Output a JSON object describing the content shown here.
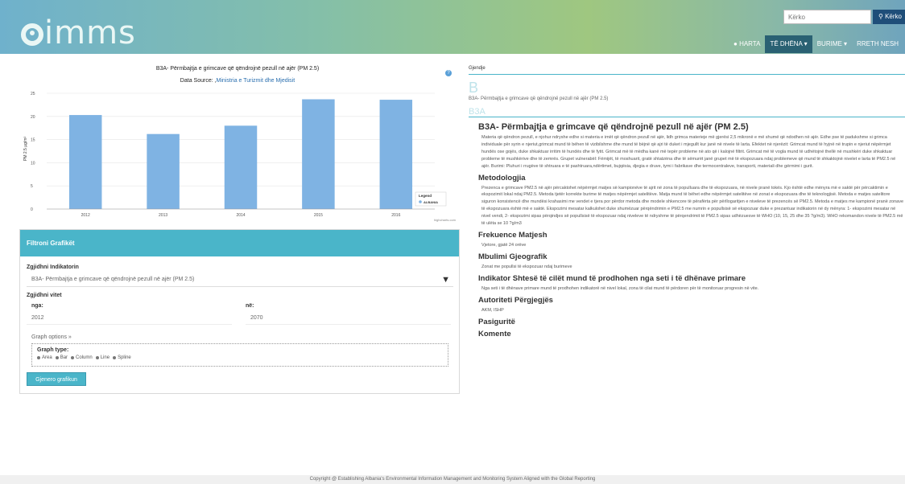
{
  "header": {
    "logo": "imms",
    "search_placeholder": "Kërko",
    "search_button": "Kërko",
    "nav": [
      "HARTA",
      "TË DHËNA",
      "BURIME",
      "RRETH NESH"
    ]
  },
  "chart_data": {
    "type": "bar",
    "title": "B3A- Përmbajtja e grimcave që qëndrojnë pezull në ajër (PM 2.5)",
    "source_label": "Data Source:",
    "source_link": "Ministria e Turizmit dhe Mjedisit",
    "categories": [
      "2012",
      "2013",
      "2014",
      "2015",
      "2016"
    ],
    "values": [
      20.3,
      16.2,
      18.0,
      23.7,
      23.6
    ],
    "ylabel": "PM 2.5 μg/m³",
    "ylim": [
      0,
      25
    ],
    "yticks": [
      0,
      5,
      10,
      15,
      20,
      25
    ],
    "legend_title": "Legend",
    "legend_item": "ALBANIA",
    "credit": "highcharts.com",
    "color": "#7fb3e3"
  },
  "filter": {
    "header": "Filtroni Grafikët",
    "indicator_label": "Zgjidhni Indikatorin",
    "indicator_value": "B3A- Përmbajtja e grimcave që qëndrojnë pezull në ajër (PM 2.5)",
    "years_label": "Zgjidhni vitet",
    "from_label": "nga:",
    "to_label": "në:",
    "from_value": "2012",
    "to_value": "2070",
    "graph_options": "Graph options »",
    "graph_type_label": "Graph type:",
    "graph_types": [
      "Area",
      "Bar",
      "Column",
      "Line",
      "Spline"
    ],
    "generate_button": "Gjenero grafikun"
  },
  "right": {
    "breadcrumb": "Gjendje",
    "big_letter": "B",
    "small_subtitle": "B3A- Përmbajtja e grimcave që qëndrojnë pezull në ajër (PM 2.5)",
    "code_heading": "B3A",
    "main_heading": "B3A- Përmbajtja e grimcave që qëndrojnë pezull në ajër (PM 2.5)",
    "intro": "Materia që qëndron pezull, e njohur ndryshe edhe si materia e imët që qëndron pezull në ajër, lidh grimca materieje më gjerësi 2,5 mikronë e më shumë që ndodhen në ajër. Edhe pse të padukshme si grimca individuale për syrin e njeriut,grimcat mund të bëhen të vizibilshme dhe mund të bëjnë që ajri të duket i mjegullt kur janë në nivele të larta. Efektet në njerëzit: Grimcat mund të hyjnë në trupin e njeriut nëpërmjet hundës ose gojës, duke shkaktuar irritim të hundës dhe të fytit. Grimcat më të mëdha kanë më tepër probleme në ato që i kalojnë filtrit. Grimcat më të vogla mund të udhëtojnë thellë në mushkëri duke shkaktuar probleme të mushkërive dhe të zemrës. Grupet vulnerabël: Fëmijët, të moshuarit, gratë shtatzëna dhe të sëmurët janë grupet më të ekspozuara ndaj problemeve që mund të shkaktojnë nivelet e larta të PM2.5 në ajër. Burimi: Pluhuri i rrugëve të shtruara e të pashtruara,ndërtimet, bujqësia, djegia e druve, tymi i fabrikave dhe termocentraleve, transporti, materiali dhe gërmimi i gurit.",
    "sections": [
      {
        "title": "Metodologjia",
        "text": "Prezenca e grimcave PM2.5 në ajër përcaktohet nëpërmjet matjes së kampionëve të ajrit në zona të populluara dhe të ekspozuara, në nivele pranë tokës. Kjo është edhe mënyra më e saktë për përcaktimin e ekspozimit lokal ndaj PM2.5. Metoda tjetër korrekte burime të matjes nëpërmjet satelitëve. Matja mund të bëhet edhe nëpërmjet satelitëve në zonat e ekspozuara dhe të teknologjisë. Metoda e matjes satelitore siguron konsistencë dhe mundësi krahasimi me vendet e tjera por përdor metoda dhe modele shkencore të përafërta për përllogaritjen e niveleve të prezencës së PM2.5. Metoda e matjes me kampionë pranë zonave të ekspozuara është më e saktë. Ekspozimi mesatar kalkulohet duke shumëzuar përqëndrimin e PM2.5 me numrin e popullsisë së ekspozuar duke e prezantuar indikatorin në dy mënyra: 1- ekspozimi mesatar në nivel vendi, 2- ekspozimi sipas përqindjes së popullsisë të ekspozuar ndaj niveleve të ndryshme të përqendrimit të PM2.5 sipas udhëzuesve të WHO (10, 15, 25 dhe 35 ?g/m3). WHO rekomandon nivele të PM2.5 më të ulëta se 10 ?g/m3"
      },
      {
        "title": "Frekuence Matjesh",
        "text": "Vjetore, gjatë 24 orëve"
      },
      {
        "title": "Mbulimi Gjeografik",
        "text": "Zonat me popullsi të ekspozuar ndaj burimeve"
      },
      {
        "title": "Indikator Shtesë të cilët mund të prodhohen nga seti i të dhënave primare",
        "text": "Nga seti i të dhënave primare mund të prodhohen indikatorë në nivel lokal, zona të cilat mund të përdoren për të monitoruar progresin në vite."
      },
      {
        "title": "Autoriteti Përgjegjës",
        "text": "AKM, ISHP"
      },
      {
        "title": "Pasiguritë",
        "text": ""
      },
      {
        "title": "Komente",
        "text": ""
      }
    ]
  },
  "footer": "Copyright @ Establishing Albania's Environmental Information Management and Monitoring System Aligned with the Global Reporting"
}
